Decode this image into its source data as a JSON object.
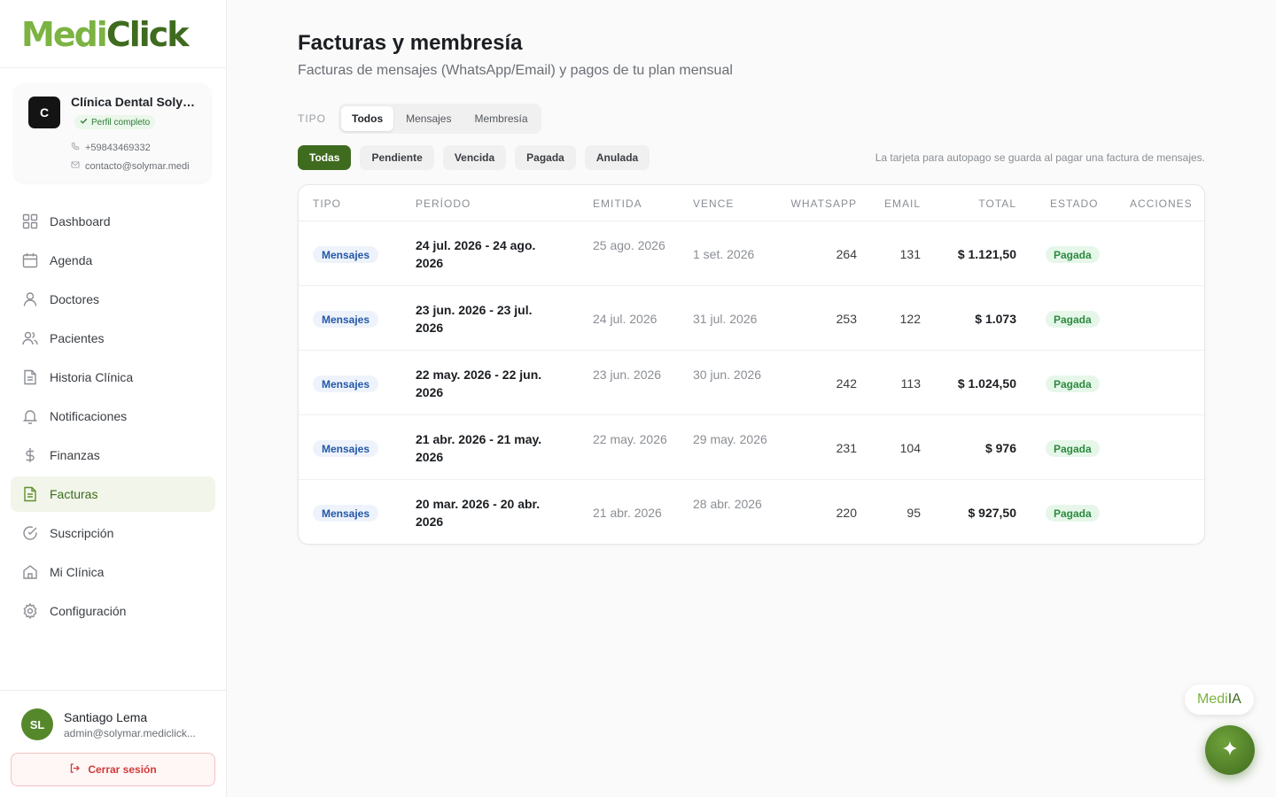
{
  "brand": {
    "part1": "Medi",
    "part2": "Click"
  },
  "clinic": {
    "initial": "C",
    "name": "Clínica Dental Solymar",
    "badge": "Perfil completo",
    "phone": "+59843469332",
    "email": "contacto@solymar.medi"
  },
  "nav": [
    {
      "label": "Dashboard",
      "icon": "grid-icon"
    },
    {
      "label": "Agenda",
      "icon": "calendar-icon"
    },
    {
      "label": "Doctores",
      "icon": "user-icon"
    },
    {
      "label": "Pacientes",
      "icon": "users-icon"
    },
    {
      "label": "Historia Clínica",
      "icon": "file-text-icon"
    },
    {
      "label": "Notificaciones",
      "icon": "bell-icon"
    },
    {
      "label": "Finanzas",
      "icon": "dollar-icon"
    },
    {
      "label": "Facturas",
      "icon": "invoice-icon",
      "active": true
    },
    {
      "label": "Suscripción",
      "icon": "check-circle-icon"
    },
    {
      "label": "Mi Clínica",
      "icon": "home-icon"
    },
    {
      "label": "Configuración",
      "icon": "gear-icon"
    }
  ],
  "user": {
    "initials": "SL",
    "name": "Santiago Lema",
    "email": "admin@solymar.mediclick...",
    "logout_label": "Cerrar sesión"
  },
  "page": {
    "title": "Facturas y membresía",
    "subtitle": "Facturas de mensajes (WhatsApp/Email) y pagos de tu plan mensual"
  },
  "type_filter": {
    "label": "TIPO",
    "options": [
      "Todos",
      "Mensajes",
      "Membresía"
    ],
    "selected": "Todos"
  },
  "status_filter": {
    "options": [
      "Todas",
      "Pendiente",
      "Vencida",
      "Pagada",
      "Anulada"
    ],
    "selected": "Todas"
  },
  "hint": "La tarjeta para autopago se guarda al pagar una factura de mensajes.",
  "table": {
    "headers": {
      "tipo": "TIPO",
      "periodo": "PERÍODO",
      "emitida": "EMITIDA",
      "vence": "VENCE",
      "whatsapp": "WHATSAPP",
      "email": "EMAIL",
      "total": "TOTAL",
      "estado": "ESTADO",
      "acciones": "ACCIONES"
    },
    "rows": [
      {
        "tipo": "Mensajes",
        "periodo": "24 jul. 2026 - 24 ago. 2026",
        "emitida": "25 ago. 2026",
        "vence": "1 set. 2026",
        "whatsapp": "264",
        "email": "131",
        "total": "$ 1.121,50",
        "estado": "Pagada"
      },
      {
        "tipo": "Mensajes",
        "periodo": "23 jun. 2026 - 23 jul. 2026",
        "emitida": "24 jul. 2026",
        "vence": "31 jul. 2026",
        "whatsapp": "253",
        "email": "122",
        "total": "$ 1.073",
        "estado": "Pagada"
      },
      {
        "tipo": "Mensajes",
        "periodo": "22 may. 2026 - 22 jun. 2026",
        "emitida": "23 jun. 2026",
        "vence": "30 jun. 2026",
        "whatsapp": "242",
        "email": "113",
        "total": "$ 1.024,50",
        "estado": "Pagada"
      },
      {
        "tipo": "Mensajes",
        "periodo": "21 abr. 2026 - 21 may. 2026",
        "emitida": "22 may. 2026",
        "vence": "29 may. 2026",
        "whatsapp": "231",
        "email": "104",
        "total": "$ 976",
        "estado": "Pagada"
      },
      {
        "tipo": "Mensajes",
        "periodo": "20 mar. 2026 - 20 abr. 2026",
        "emitida": "21 abr. 2026",
        "vence": "28 abr. 2026",
        "whatsapp": "220",
        "email": "95",
        "total": "$ 927,50",
        "estado": "Pagada"
      }
    ]
  },
  "assistant": {
    "part1": "Medi",
    "part2": "IA",
    "icon": "sparkle-icon"
  },
  "colors": {
    "brand_light": "#7cb342",
    "brand_dark": "#3f6b1f",
    "paid_badge": "#2c8a3e",
    "type_badge": "#2458a8",
    "logout": "#d33a3a"
  }
}
